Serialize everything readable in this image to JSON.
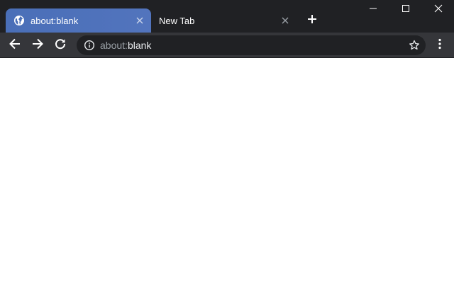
{
  "tabs": [
    {
      "title": "about:blank",
      "active": true,
      "favicon": "globe-icon"
    },
    {
      "title": "New Tab",
      "active": false,
      "favicon": ""
    }
  ],
  "new_tab_icon": "plus-icon",
  "window_controls": {
    "minimize_icon": "minimize-icon",
    "maximize_icon": "maximize-icon",
    "close_icon": "close-icon"
  },
  "toolbar": {
    "back_icon": "back-arrow-icon",
    "forward_icon": "forward-arrow-icon",
    "reload_icon": "reload-icon",
    "menu_icon": "kebab-menu-icon"
  },
  "omnibox": {
    "info_icon": "info-icon",
    "url_scheme": "about:",
    "url_rest": "blank",
    "bookmark_icon": "star-outline-icon"
  },
  "colors": {
    "tabstrip_bg": "#202124",
    "active_tab": "#4f72ba",
    "toolbar_bg": "#35363a",
    "omnibox_bg": "#202124",
    "content_bg": "#ffffff"
  }
}
